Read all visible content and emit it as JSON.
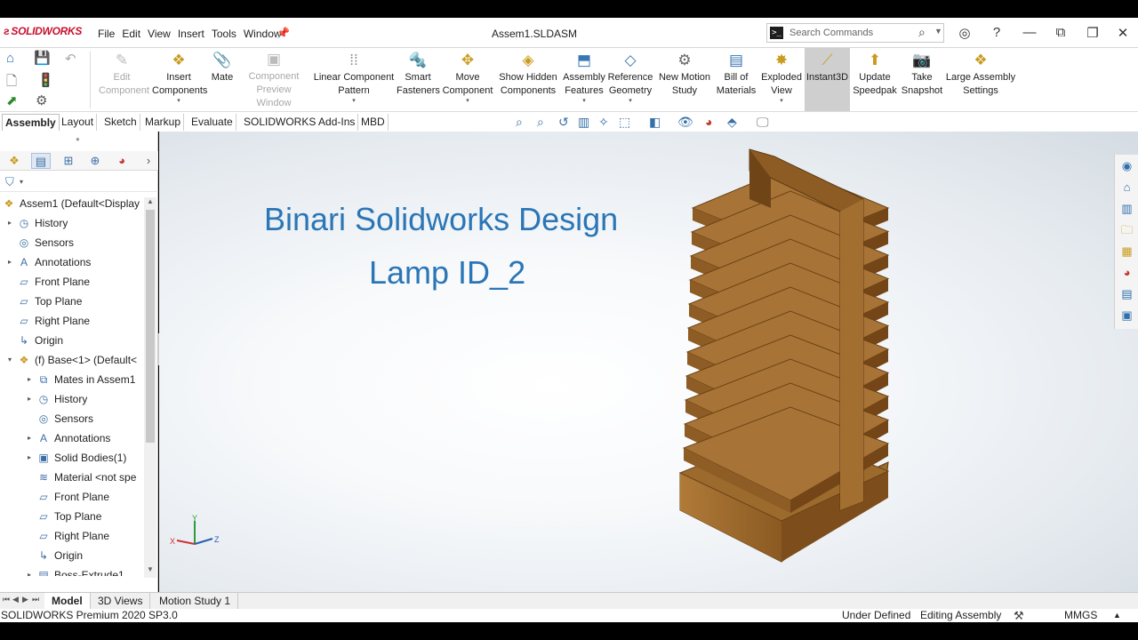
{
  "app": {
    "logo": "SOLIDWORKS",
    "document_title": "Assem1.SLDASM"
  },
  "menu": [
    "File",
    "Edit",
    "View",
    "Insert",
    "Tools",
    "Window"
  ],
  "search": {
    "placeholder": "Search Commands"
  },
  "ribbon": {
    "edit_component": "Edit Component",
    "insert_components": "Insert Components",
    "mate": "Mate",
    "component_preview": "Component Preview Window",
    "linear_pattern": "Linear Component Pattern",
    "smart_fasteners": "Smart Fasteners",
    "move_component": "Move Component",
    "show_hidden": "Show Hidden Components",
    "assembly_features": "Assembly Features",
    "reference_geometry": "Reference Geometry",
    "new_motion_study": "New Motion Study",
    "bill_of_materials": "Bill of Materials",
    "exploded_view": "Exploded View",
    "instant3d": "Instant3D",
    "update_speedpak": "Update Speedpak",
    "take_snapshot": "Take Snapshot",
    "large_assembly": "Large Assembly Settings"
  },
  "command_tabs": [
    "Assembly",
    "Layout",
    "Sketch",
    "Markup",
    "Evaluate",
    "SOLIDWORKS Add-Ins",
    "MBD"
  ],
  "tree": [
    {
      "label": "Assem1  (Default<Display",
      "level": 0,
      "icon": "assembly-icon",
      "expand": ""
    },
    {
      "label": "History",
      "level": 1,
      "icon": "history-icon",
      "expand": "▸"
    },
    {
      "label": "Sensors",
      "level": 1,
      "icon": "sensors-icon",
      "expand": ""
    },
    {
      "label": "Annotations",
      "level": 1,
      "icon": "annotations-icon",
      "expand": "▸"
    },
    {
      "label": "Front Plane",
      "level": 1,
      "icon": "plane-icon",
      "expand": ""
    },
    {
      "label": "Top Plane",
      "level": 1,
      "icon": "plane-icon",
      "expand": ""
    },
    {
      "label": "Right Plane",
      "level": 1,
      "icon": "plane-icon",
      "expand": ""
    },
    {
      "label": "Origin",
      "level": 1,
      "icon": "origin-icon",
      "expand": ""
    },
    {
      "label": "(f) Base<1> (Default<",
      "level": 1,
      "icon": "part-icon",
      "expand": "▾"
    },
    {
      "label": "Mates in Assem1",
      "level": 2,
      "icon": "mates-icon",
      "expand": "▸"
    },
    {
      "label": "History",
      "level": 2,
      "icon": "history-icon",
      "expand": "▸"
    },
    {
      "label": "Sensors",
      "level": 2,
      "icon": "sensors-icon",
      "expand": ""
    },
    {
      "label": "Annotations",
      "level": 2,
      "icon": "annotations-icon",
      "expand": "▸"
    },
    {
      "label": "Solid Bodies(1)",
      "level": 2,
      "icon": "solid-bodies-icon",
      "expand": "▸"
    },
    {
      "label": "Material <not spe",
      "level": 2,
      "icon": "material-icon",
      "expand": ""
    },
    {
      "label": "Front Plane",
      "level": 2,
      "icon": "plane-icon",
      "expand": ""
    },
    {
      "label": "Top Plane",
      "level": 2,
      "icon": "plane-icon",
      "expand": ""
    },
    {
      "label": "Right Plane",
      "level": 2,
      "icon": "plane-icon",
      "expand": ""
    },
    {
      "label": "Origin",
      "level": 2,
      "icon": "origin-icon",
      "expand": ""
    },
    {
      "label": "Boss-Extrude1",
      "level": 2,
      "icon": "extrude-icon",
      "expand": "▸"
    }
  ],
  "viewport": {
    "title_line1": "Binari Solidworks Design",
    "title_line2": "Lamp ID_2",
    "triad": {
      "x": "X",
      "y": "Y",
      "z": "Z"
    },
    "model_color": "#8a5a22"
  },
  "bottom_tabs": [
    "Model",
    "3D Views",
    "Motion Study 1"
  ],
  "status": {
    "product": "SOLIDWORKS Premium 2020 SP3.0",
    "state": "Under Defined",
    "mode": "Editing Assembly",
    "units": "MMGS"
  }
}
